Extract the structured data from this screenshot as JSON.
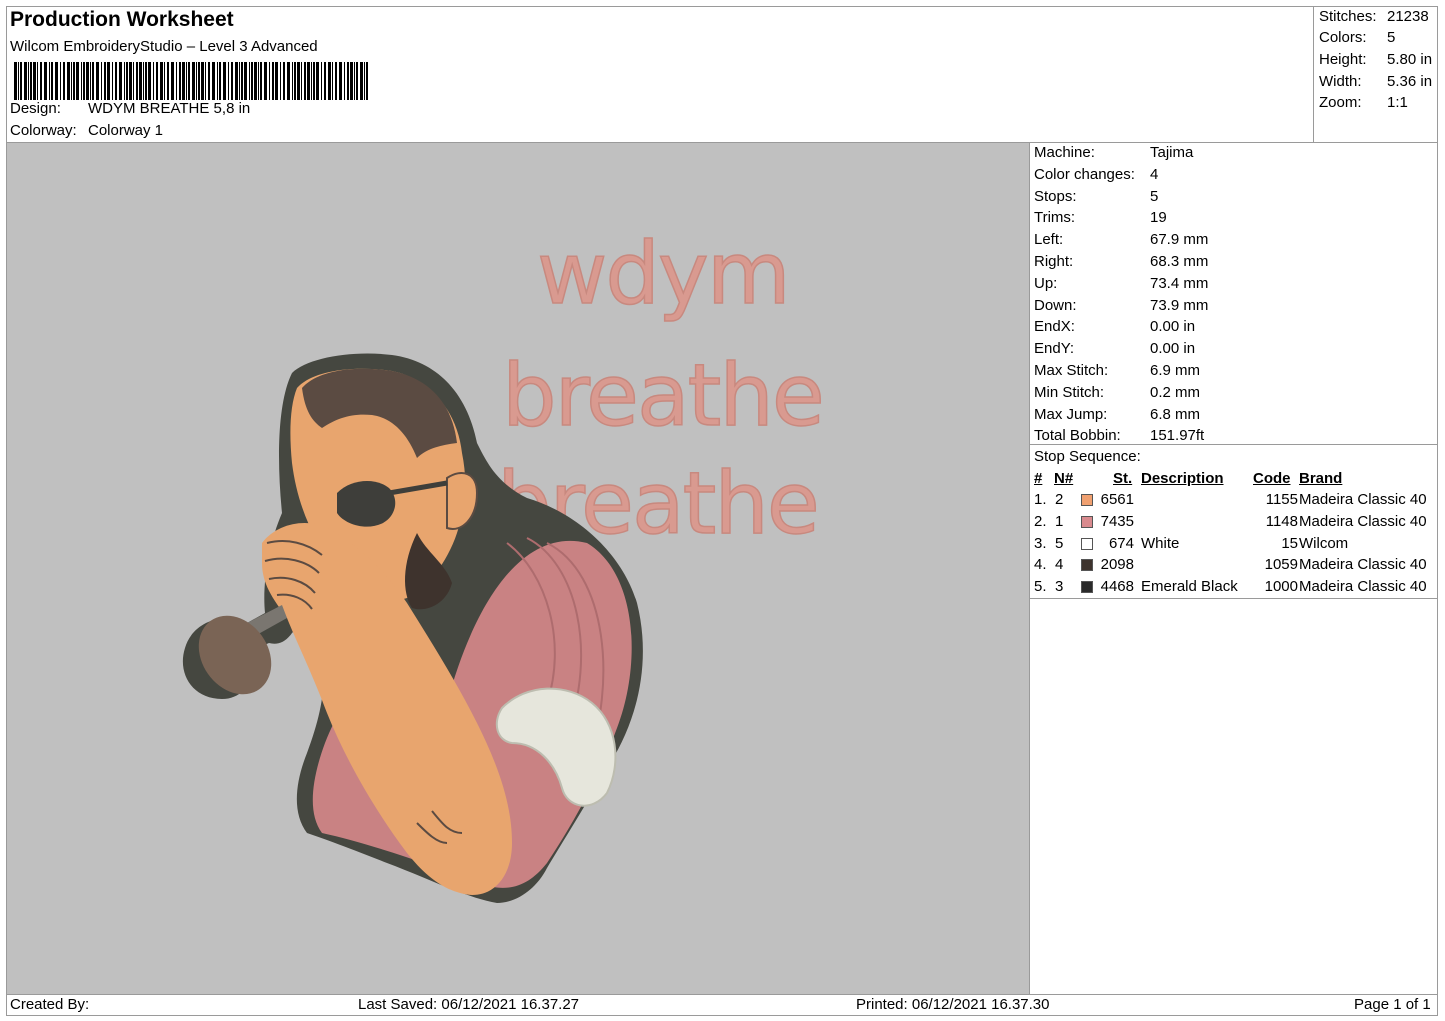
{
  "header": {
    "title": "Production Worksheet",
    "software": "Wilcom EmbroideryStudio – Level 3 Advanced",
    "design_label": "Design:",
    "design_value": "WDYM BREATHE 5,8 in",
    "colorway_label": "Colorway:",
    "colorway_value": "Colorway 1"
  },
  "stats": [
    {
      "label": "Stitches:",
      "value": "21238"
    },
    {
      "label": "Colors:",
      "value": "5"
    },
    {
      "label": "Height:",
      "value": "5.80 in"
    },
    {
      "label": "Width:",
      "value": "5.36 in"
    },
    {
      "label": "Zoom:",
      "value": "1:1"
    }
  ],
  "machine": [
    {
      "label": "Machine:",
      "value": "Tajima"
    },
    {
      "label": "Color changes:",
      "value": "4"
    },
    {
      "label": "Stops:",
      "value": "5"
    },
    {
      "label": "Trims:",
      "value": "19"
    },
    {
      "label": "Left:",
      "value": "67.9 mm"
    },
    {
      "label": "Right:",
      "value": "68.3 mm"
    },
    {
      "label": "Up:",
      "value": "73.4 mm"
    },
    {
      "label": "Down:",
      "value": "73.9 mm"
    },
    {
      "label": "EndX:",
      "value": "0.00 in"
    },
    {
      "label": "EndY:",
      "value": "0.00 in"
    },
    {
      "label": "Max Stitch:",
      "value": "6.9 mm"
    },
    {
      "label": "Min Stitch:",
      "value": "0.2 mm"
    },
    {
      "label": "Max Jump:",
      "value": "6.8 mm"
    },
    {
      "label": "Total Bobbin:",
      "value": "151.97ft"
    }
  ],
  "stop_sequence": {
    "caption": "Stop Sequence:",
    "headers": {
      "num": "#",
      "n": "N#",
      "st": "St.",
      "desc": "Description",
      "code": "Code",
      "brand": "Brand"
    },
    "rows": [
      {
        "num": "1.",
        "n": "2",
        "color": "#F0A070",
        "st": "6561",
        "desc": "",
        "code": "1155",
        "brand": "Madeira Classic 40"
      },
      {
        "num": "2.",
        "n": "1",
        "color": "#D98A8E",
        "st": "7435",
        "desc": "",
        "code": "1148",
        "brand": "Madeira Classic 40"
      },
      {
        "num": "3.",
        "n": "5",
        "color": "#FFFFFF",
        "st": "674",
        "desc": "White",
        "code": "15",
        "brand": "Wilcom"
      },
      {
        "num": "4.",
        "n": "4",
        "color": "#3E332D",
        "st": "2098",
        "desc": "",
        "code": "1059",
        "brand": "Madeira Classic 40"
      },
      {
        "num": "5.",
        "n": "3",
        "color": "#2A2A2A",
        "st": "4468",
        "desc": "Emerald Black",
        "code": "1000",
        "brand": "Madeira Classic 40"
      }
    ]
  },
  "design_text": [
    "wdym",
    "breathe",
    "breathe"
  ],
  "colors": {
    "background": "#C0C0C0",
    "skin": "#E8A56E",
    "shirt": "#C98283",
    "hair": "#5B4B42",
    "outline": "#454740",
    "white": "#E6E6DC",
    "text": "#D99A90"
  },
  "footer": {
    "created_by": "Created By:",
    "last_saved": "Last Saved: 06/12/2021 16.37.27",
    "printed": "Printed: 06/12/2021 16.37.30",
    "page": "Page 1 of 1"
  }
}
